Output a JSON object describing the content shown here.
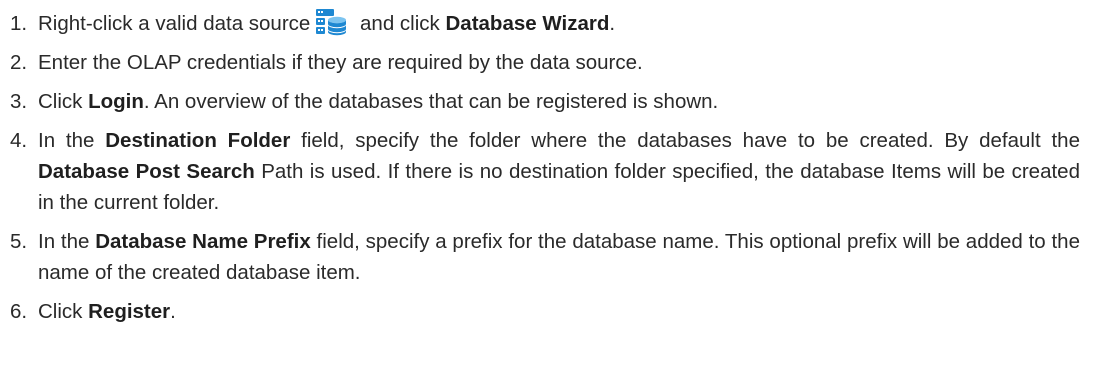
{
  "steps": [
    {
      "num": "1.",
      "parts": {
        "a": "Right-click a valid data source",
        "b": " and click ",
        "c": "Database Wizard",
        "d": "."
      },
      "icon": "database-source-icon"
    },
    {
      "num": "2.",
      "text": "Enter the OLAP credentials if they are required by the data source."
    },
    {
      "num": "3.",
      "parts": {
        "a": "Click ",
        "b": "Login",
        "c": ". An overview of the databases that can be registered is shown."
      }
    },
    {
      "num": "4.",
      "parts": {
        "a": "In the ",
        "b": "Destination Folder",
        "c": " field, specify the folder where the databases have to be created. By default the ",
        "d": "Database Post Search",
        "e": " Path is used. If there is no destination folder specified, the database Items will be created in the current folder."
      }
    },
    {
      "num": "5.",
      "parts": {
        "a": "In the ",
        "b": "Database Name Prefix",
        "c": " field, specify a prefix for the database name. This optional prefix will be added to the name of the created database item."
      }
    },
    {
      "num": "6.",
      "parts": {
        "a": "Click ",
        "b": "Register",
        "c": "."
      }
    }
  ],
  "colors": {
    "text": "#2a2a2a",
    "icon_blue": "#1e88d2",
    "icon_light": "#7cc4f0"
  }
}
